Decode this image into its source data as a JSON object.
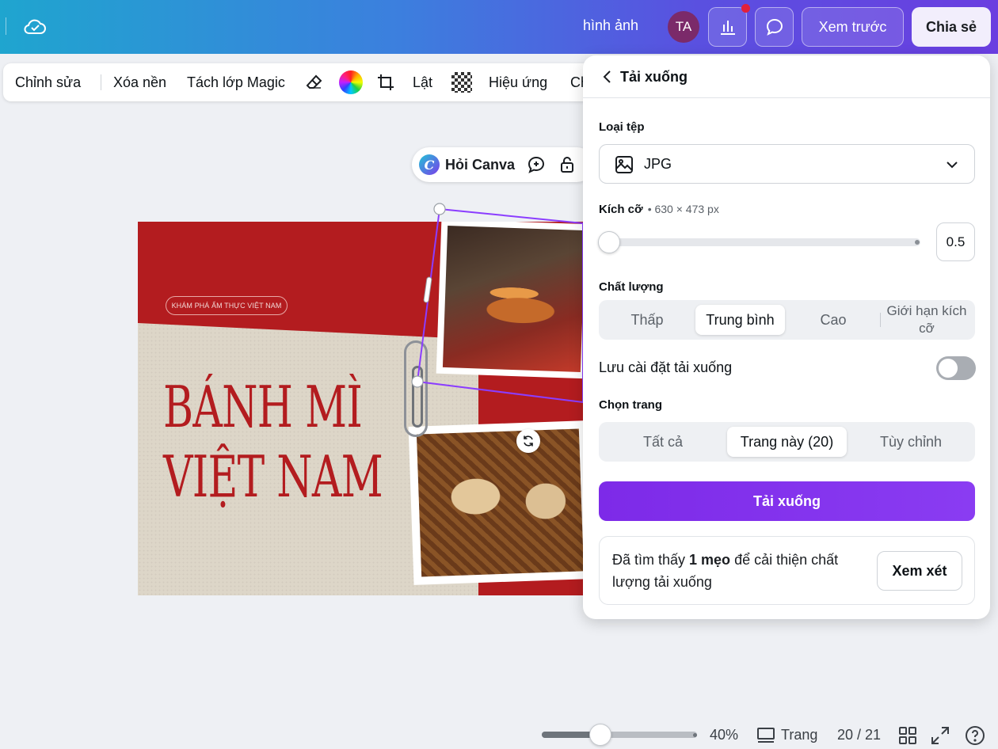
{
  "topbar": {
    "label": "hình ảnh",
    "avatar_initials": "TA",
    "preview_label": "Xem trước",
    "share_label": "Chia sẻ"
  },
  "toolbar": {
    "edit": "Chỉnh sửa",
    "remove_bg": "Xóa nền",
    "magic_layers": "Tách lớp Magic",
    "flip": "Lật",
    "effects": "Hiệu ứng",
    "more": "Ch"
  },
  "ask_canva": {
    "label": "Hỏi Canva"
  },
  "design": {
    "tag": "KHÁM PHÁ ẨM THỰC VIỆT NAM",
    "title_line1": "BÁNH MÌ",
    "title_line2": "VIỆT NAM"
  },
  "download_panel": {
    "title": "Tải xuống",
    "file_type_label": "Loại tệp",
    "file_type_value": "JPG",
    "size_label": "Kích cỡ",
    "size_value": "• 630 × 473 px",
    "size_multiplier": "0.5",
    "size_multiplier_fraction": 0.0,
    "quality_label": "Chất lượng",
    "quality_options": [
      "Thấp",
      "Trung bình",
      "Cao",
      "Giới hạn kích cỡ"
    ],
    "quality_selected": "Trung bình",
    "save_settings_label": "Lưu cài đặt tải xuống",
    "save_settings_on": false,
    "pages_label": "Chọn trang",
    "pages_options": [
      "Tất cả",
      "Trang này (20)",
      "Tùy chỉnh"
    ],
    "pages_selected": "Trang này (20)",
    "download_button": "Tải xuống",
    "tip_prefix": "Đã tìm thấy ",
    "tip_bold": "1 mẹo",
    "tip_suffix": " để cải thiện chất lượng tải xuống",
    "tip_button": "Xem xét"
  },
  "bottombar": {
    "zoom": "40%",
    "zoom_fraction": 0.38,
    "pages_label": "Trang",
    "page_counter": "20 / 21"
  },
  "colors": {
    "accent": "#7d2ae8",
    "design_red": "#b31c1f",
    "notification": "#e2203a"
  }
}
